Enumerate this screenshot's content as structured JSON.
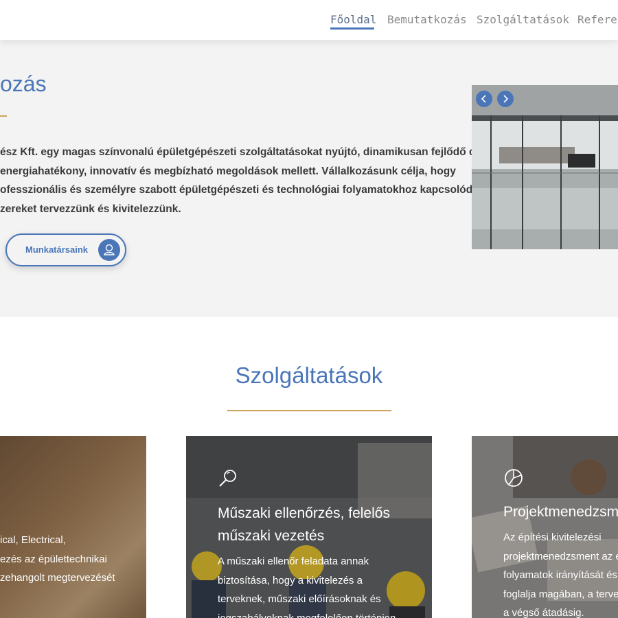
{
  "nav": {
    "items": [
      "Főoldal",
      "Bemutatkozás",
      "Szolgáltatások",
      "Referen"
    ],
    "active": "Főoldal"
  },
  "intro": {
    "title": "ozás",
    "lines": [
      "ész Kft. egy magas színvonalú épületgépészeti szolgáltatásokat nyújtó, dinamikusan fejlődő cég,",
      "energiahatékony, innovatív és megbízható megoldások mellett. Vállalkozásunk célja, hogy",
      "ofesszionális és személyre szabott épületgépészeti és  technológiai folyamatokhoz kapcsolódó",
      "zereket tervezzünk és  kivitelezzünk."
    ],
    "button_label": "Munkatársaink",
    "button_icon": "user-icon"
  },
  "slider": {
    "prev_icon": "chevron-left-icon",
    "next_icon": "chevron-right-icon"
  },
  "services": {
    "title": "Szolgáltatások",
    "cards": [
      {
        "heading_lines": [],
        "text_lines": [
          "ical, Electrical,",
          "ezés az épülettechnikai",
          "zehangolt megtervezését"
        ]
      },
      {
        "icon": "search-icon",
        "heading_lines": [
          "Műszaki ellenőrzés, felelős",
          "műszaki vezetés"
        ],
        "text_lines": [
          "A műszaki ellenőr feladata annak",
          "biztosítása, hogy a kivitelezés a",
          "terveknek, műszaki előírásoknak és",
          "jogszabályoknak megfelelően történjen"
        ]
      },
      {
        "icon": "pie-chart-icon",
        "heading_lines": [
          "Projektmenedzsment"
        ],
        "text_lines": [
          "Az építési kivitelezési",
          "projektmenedzsment az é",
          "folyamatok irányítását és",
          "foglalja magában, a terve",
          "a végső átadásig."
        ]
      }
    ]
  },
  "colors": {
    "accent": "#4a76b8",
    "gold": "#c9a45c",
    "text": "#3a3a3a",
    "intro_bg": "#f3f3f3"
  }
}
